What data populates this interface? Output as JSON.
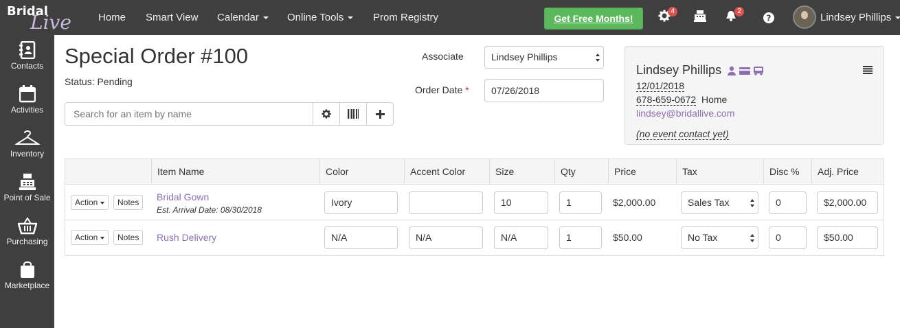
{
  "brand": {
    "word1": "Bridal",
    "word2": "Live"
  },
  "nav": {
    "home": "Home",
    "smart_view": "Smart View",
    "calendar": "Calendar",
    "online_tools": "Online Tools",
    "prom_registry": "Prom Registry",
    "promo": "Get Free Months!",
    "settings_badge": "4",
    "notifications_badge": "2",
    "user_name": "Lindsey Phillips"
  },
  "sidebar": {
    "items": [
      {
        "label": "Contacts",
        "icon": "contacts-icon"
      },
      {
        "label": "Activities",
        "icon": "calendar-icon"
      },
      {
        "label": "Inventory",
        "icon": "hanger-icon"
      },
      {
        "label": "Point of Sale",
        "icon": "register-icon"
      },
      {
        "label": "Purchasing",
        "icon": "basket-icon"
      },
      {
        "label": "Marketplace",
        "icon": "bag-icon"
      }
    ]
  },
  "order": {
    "title": "Special Order #100",
    "status": "Status: Pending",
    "search_placeholder": "Search for an item by name",
    "associate_label": "Associate",
    "associate_value": "Lindsey Phillips",
    "order_date_label": "Order Date",
    "order_date_required": "*",
    "order_date_value": "07/26/2018"
  },
  "contact": {
    "name": "Lindsey Phillips",
    "date": "12/01/2018",
    "phone": "678-659-0672",
    "phone_type": "Home",
    "email": "lindsey@bridallive.com",
    "event": "(no event contact yet)"
  },
  "table": {
    "headers": {
      "item_name": "Item Name",
      "color": "Color",
      "accent_color": "Accent Color",
      "size": "Size",
      "qty": "Qty",
      "price": "Price",
      "tax": "Tax",
      "disc": "Disc %",
      "adj_price": "Adj. Price"
    },
    "action_label": "Action",
    "notes_label": "Notes",
    "rows": [
      {
        "item_name": "Bridal Gown",
        "arrival": "Est. Arrival Date: 08/30/2018",
        "color": "Ivory",
        "accent_color": "",
        "size": "10",
        "qty": "1",
        "price": "$2,000.00",
        "tax": "Sales Tax",
        "disc": "0",
        "adj_price": "$2,000.00"
      },
      {
        "item_name": "Rush Delivery",
        "arrival": "",
        "color": "N/A",
        "accent_color": "N/A",
        "size": "N/A",
        "qty": "1",
        "price": "$50.00",
        "tax": "No Tax",
        "disc": "0",
        "adj_price": "$50.00"
      }
    ]
  },
  "colors": {
    "nav_bg": "#3f3f3f",
    "promo_green": "#5cb85c",
    "link_purple": "#8e6fb3",
    "badge_red": "#d9534f"
  }
}
